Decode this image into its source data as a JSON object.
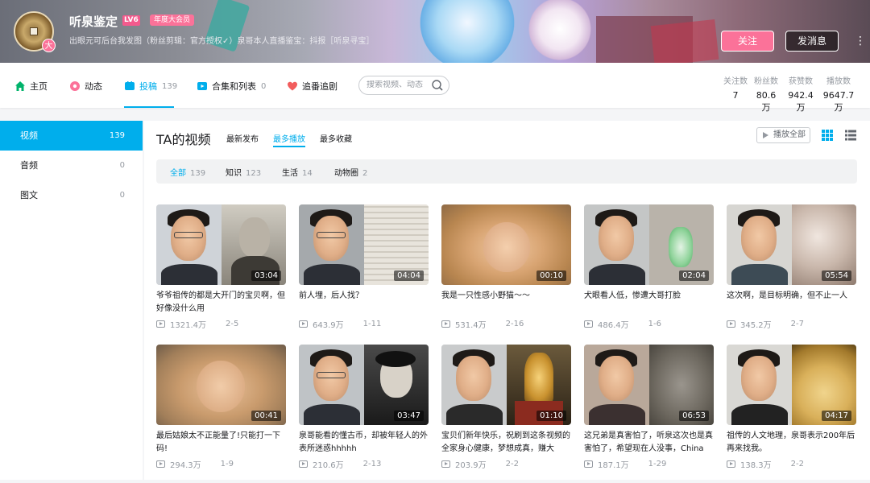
{
  "header": {
    "username": "听泉鉴定",
    "level": "LV6",
    "vip": "年度大会员",
    "avatar_badge": "大",
    "signature": "出眼元可后台我发图（粉丝剪辑：官方授权✓）泉哥本人直播鉴宝：抖报［听泉寻宝］",
    "follow_label": "关注",
    "message_label": "发消息",
    "more_label": "⋮"
  },
  "nav": {
    "items": [
      {
        "label": "主页",
        "count": ""
      },
      {
        "label": "动态",
        "count": ""
      },
      {
        "label": "投稿",
        "count": "139"
      },
      {
        "label": "合集和列表",
        "count": "0"
      },
      {
        "label": "追番追剧",
        "count": ""
      }
    ],
    "search_placeholder": "搜索视频、动态"
  },
  "stats": [
    {
      "label": "关注数",
      "value": "7"
    },
    {
      "label": "粉丝数",
      "value": "80.6万"
    },
    {
      "label": "获赞数",
      "value": "942.4万"
    },
    {
      "label": "播放数",
      "value": "9647.7万"
    }
  ],
  "sidebar": [
    {
      "label": "视频",
      "count": "139"
    },
    {
      "label": "音频",
      "count": "0"
    },
    {
      "label": "图文",
      "count": "0"
    }
  ],
  "main": {
    "title": "TA的视频",
    "sorts": [
      "最新发布",
      "最多播放",
      "最多收藏"
    ],
    "play_all": "播放全部",
    "filters": [
      {
        "label": "全部",
        "count": "139"
      },
      {
        "label": "知识",
        "count": "123"
      },
      {
        "label": "生活",
        "count": "14"
      },
      {
        "label": "动物圈",
        "count": "2"
      }
    ]
  },
  "colors": {
    "accent": "#00aeec",
    "pink": "#fb7299"
  },
  "videos": [
    {
      "duration": "03:04",
      "title": "爷爷祖传的都是大开门的宝贝啊，但好像没什么用",
      "views": "1321.4万",
      "date": "2-5"
    },
    {
      "duration": "04:04",
      "title": "前人埋，后人找？",
      "views": "643.9万",
      "date": "1-11"
    },
    {
      "duration": "00:10",
      "title": "我是一只性感小野猫～～",
      "views": "531.4万",
      "date": "2-16"
    },
    {
      "duration": "02:04",
      "title": "犬眼看人低，惨遭大哥打脸",
      "views": "486.4万",
      "date": "1-6"
    },
    {
      "duration": "05:54",
      "title": "这次啊，是目标明确，但不止一人",
      "views": "345.2万",
      "date": "2-7"
    },
    {
      "duration": "00:41",
      "title": "最后姑娘太不正能量了!只能打一下码!",
      "views": "294.3万",
      "date": "1-9"
    },
    {
      "duration": "03:47",
      "title": "泉哥能看的懂古币，却被年轻人的外表所迷惑hhhhh",
      "views": "210.6万",
      "date": "2-13"
    },
    {
      "duration": "01:10",
      "title": "宝贝们新年快乐，祝刷到这条视频的全家身心健康，梦想成真，赚大",
      "views": "203.9万",
      "date": "2-2"
    },
    {
      "duration": "06:53",
      "title": "这兄弟是真害怕了，听泉这次也是真害怕了，希望现在人没事，China",
      "views": "187.1万",
      "date": "1-29"
    },
    {
      "duration": "04:17",
      "title": "祖传的人文地理，泉哥表示200年后再来找我。",
      "views": "138.3万",
      "date": "2-2"
    }
  ]
}
